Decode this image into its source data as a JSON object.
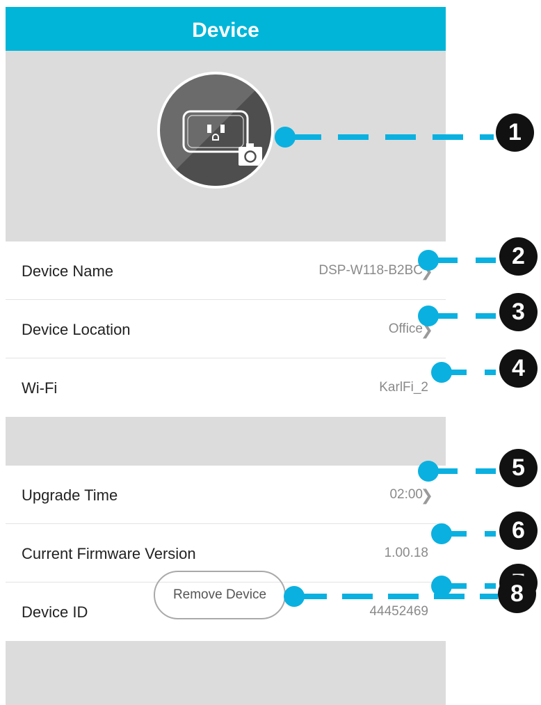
{
  "header": {
    "title": "Device"
  },
  "device_image": {
    "icon": "smart-plug-icon",
    "camera_icon": "camera-icon"
  },
  "settings": [
    {
      "label": "Device Name",
      "value": "DSP-W118-B2BC",
      "chevron": true
    },
    {
      "label": "Device Location",
      "value": "Office",
      "chevron": true
    },
    {
      "label": "Wi-Fi",
      "value": "KarlFi_2",
      "chevron": false
    }
  ],
  "info": [
    {
      "label": "Upgrade Time",
      "value": "02:00",
      "chevron": true
    },
    {
      "label": "Current Firmware Version",
      "value": "1.00.18",
      "chevron": false
    },
    {
      "label": "Device ID",
      "value": "44452469",
      "chevron": false
    }
  ],
  "remove_button": {
    "label": "Remove Device"
  },
  "callouts": [
    "1",
    "2",
    "3",
    "4",
    "5",
    "6",
    "7",
    "8"
  ],
  "colors": {
    "header": "#00b5d8",
    "callout_line": "#0ab1e0",
    "badge": "#111111",
    "section_bg": "#dcdcdc"
  }
}
